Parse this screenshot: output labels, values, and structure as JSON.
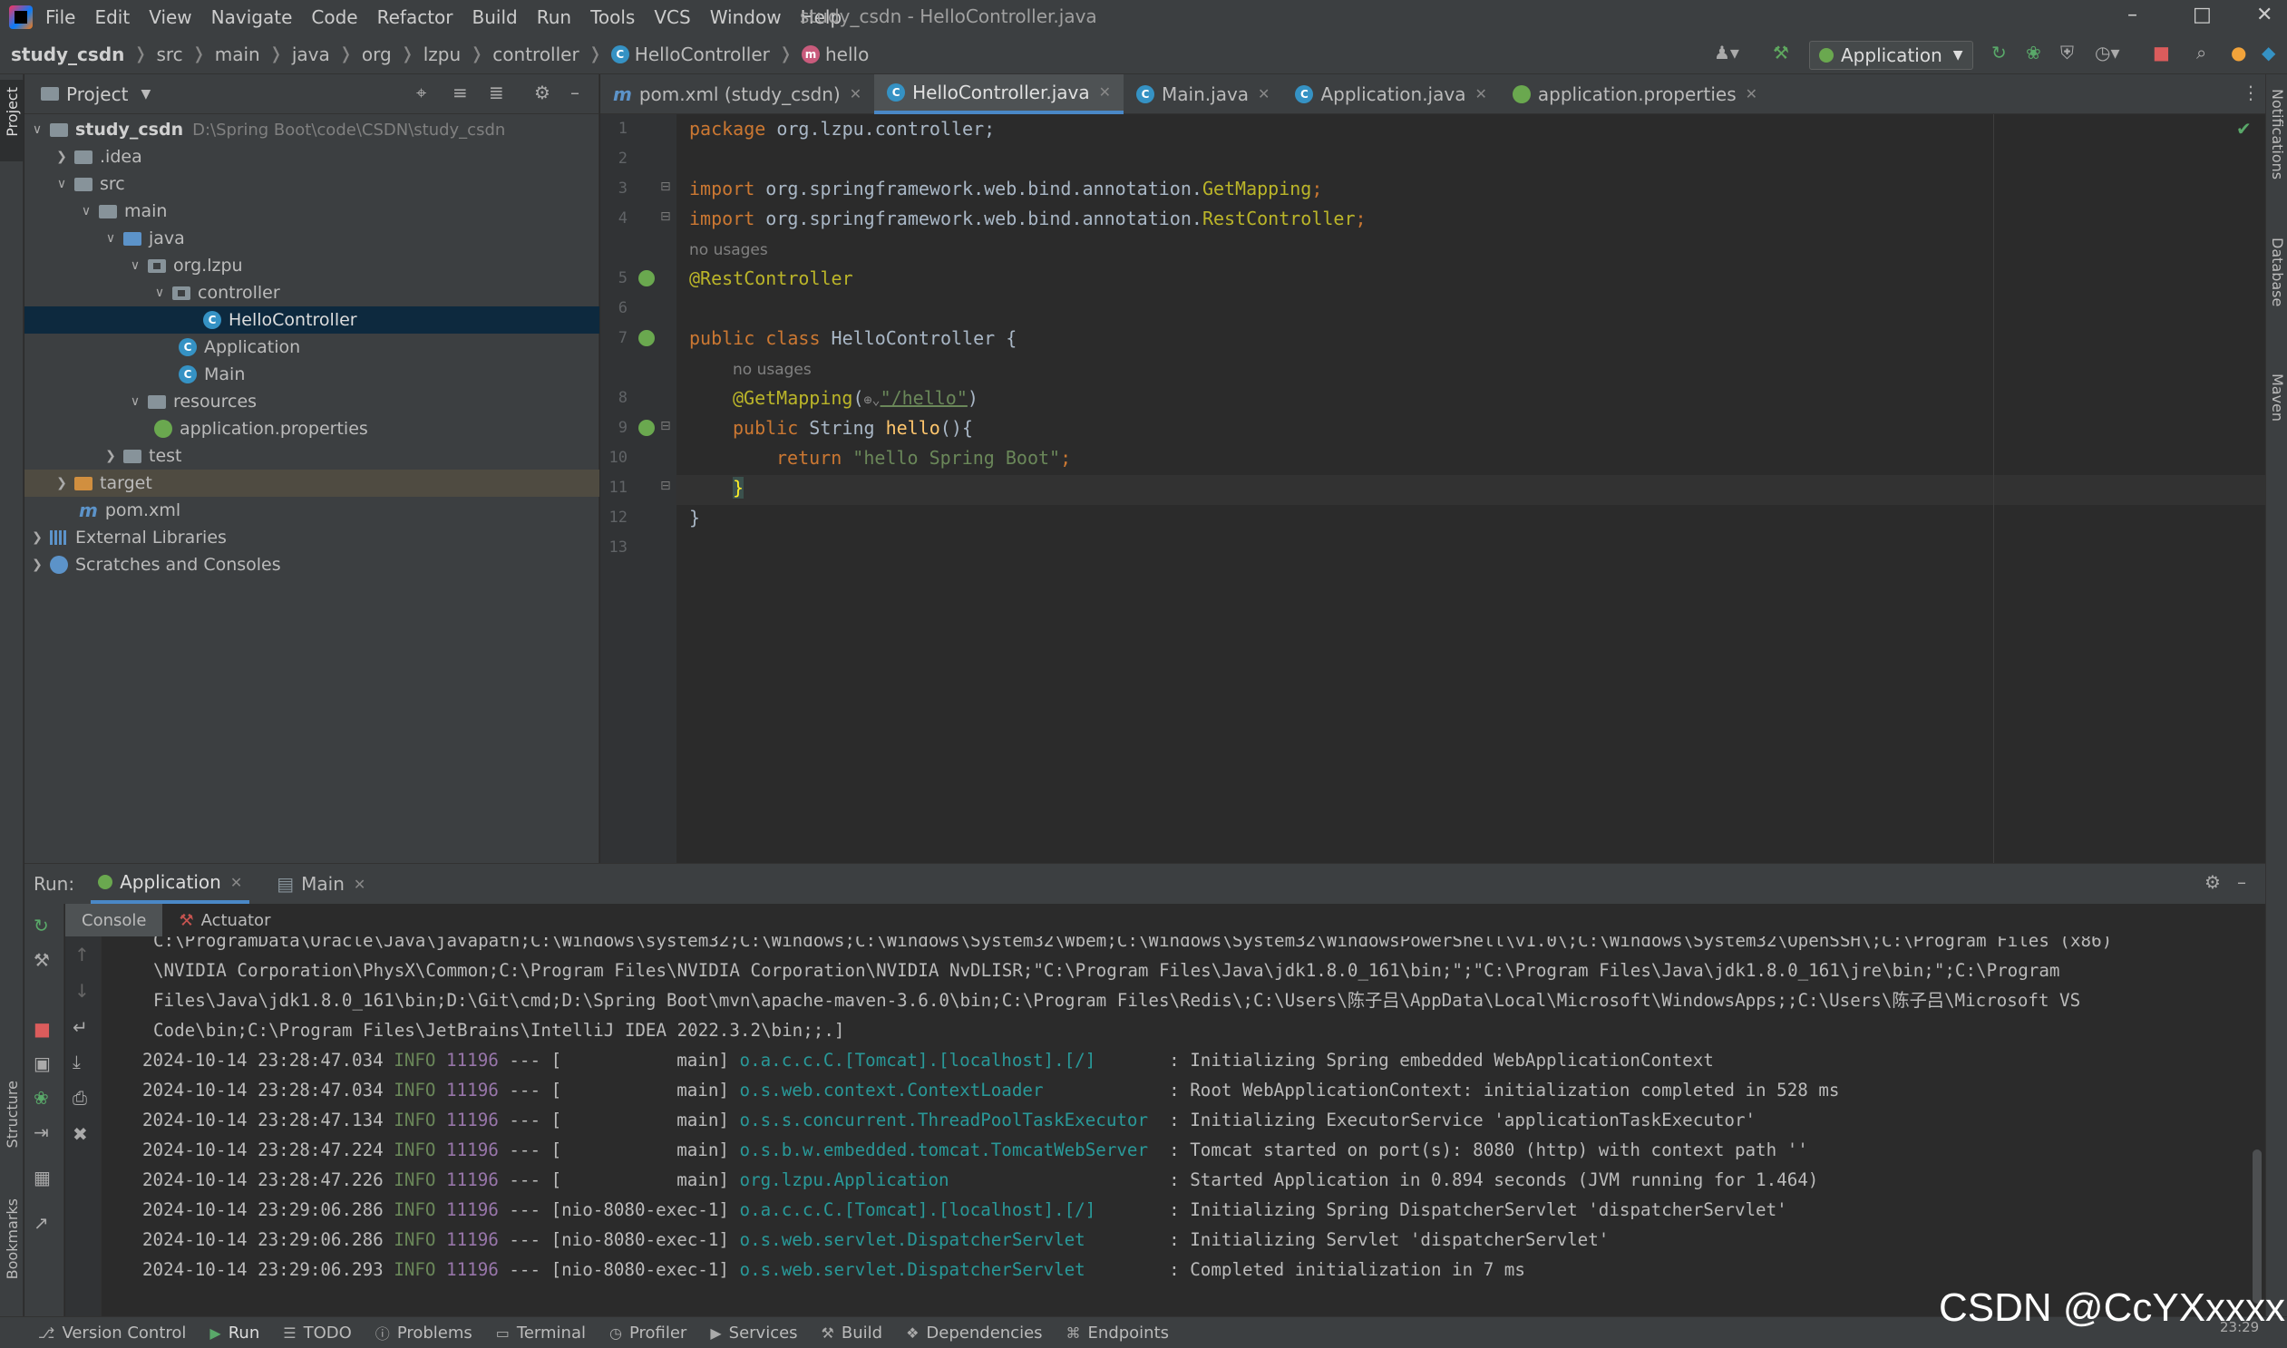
{
  "app": {
    "title": "study_csdn - HelloController.java"
  },
  "menu": [
    "File",
    "Edit",
    "View",
    "Navigate",
    "Code",
    "Refactor",
    "Build",
    "Run",
    "Tools",
    "VCS",
    "Window",
    "Help"
  ],
  "breadcrumb": [
    "study_csdn",
    "src",
    "main",
    "java",
    "org",
    "lzpu",
    "controller",
    "HelloController",
    "hello"
  ],
  "run_config": "Application",
  "project_panel": {
    "title": "Project",
    "tree": [
      {
        "label": "study_csdn",
        "note": "D:\\Spring Boot\\code\\CSDN\\study_csdn"
      },
      {
        "label": ".idea"
      },
      {
        "label": "src"
      },
      {
        "label": "main"
      },
      {
        "label": "java"
      },
      {
        "label": "org.lzpu"
      },
      {
        "label": "controller"
      },
      {
        "label": "HelloController"
      },
      {
        "label": "Application"
      },
      {
        "label": "Main"
      },
      {
        "label": "resources"
      },
      {
        "label": "application.properties"
      },
      {
        "label": "test"
      },
      {
        "label": "target"
      },
      {
        "label": "pom.xml"
      },
      {
        "label": "External Libraries"
      },
      {
        "label": "Scratches and Consoles"
      }
    ]
  },
  "editor": {
    "tabs": [
      "pom.xml (study_csdn)",
      "HelloController.java",
      "Main.java",
      "Application.java",
      "application.properties"
    ],
    "active_tab": "HelloController.java",
    "lines": [
      {
        "n": "1",
        "pkg_kw": "package",
        "pkg_name": " org.lzpu.controller;"
      },
      {
        "n": "2"
      },
      {
        "n": "3",
        "imp_kw": "import",
        "imp_path": " org.springframework.web.bind.annotation.",
        "imp_ann": "GetMapping",
        "semi": ";"
      },
      {
        "n": "4",
        "imp_kw": "import",
        "imp_path": " org.springframework.web.bind.annotation.",
        "imp_ann": "RestController",
        "semi": ";"
      },
      {
        "hint": "no usages"
      },
      {
        "n": "5",
        "ann": "@RestController"
      },
      {
        "n": "6"
      },
      {
        "n": "7",
        "kw": "public class",
        "name": " HelloController {"
      },
      {
        "hint": "no usages"
      },
      {
        "n": "8",
        "ann": "@GetMapping",
        "paren_open": "(",
        "globe": "⊕⌄",
        "str": "\"/hello\"",
        "paren_close": ")"
      },
      {
        "n": "9",
        "kw": "public",
        "type": " String ",
        "meth": "hello",
        "rest": "(){"
      },
      {
        "n": "10",
        "kw": "return",
        "str": " \"hello Spring Boot\"",
        "semi": ";"
      },
      {
        "n": "11",
        "brace": "}"
      },
      {
        "n": "12",
        "brace": "}"
      },
      {
        "n": "13"
      }
    ]
  },
  "run_panel": {
    "label": "Run:",
    "tabs": [
      "Application",
      "Main"
    ],
    "sub_tabs": [
      "Console",
      "Actuator"
    ],
    "path_lines": [
      "C:\\ProgramData\\Oracle\\Java\\javapath;C:\\Windows\\system32;C:\\Windows;C:\\Windows\\System32\\Wbem;C:\\Windows\\System32\\WindowsPowerShell\\v1.0\\;C:\\Windows\\System32\\OpenSSH\\;C:\\Program Files (x86)",
      "\\NVIDIA Corporation\\PhysX\\Common;C:\\Program Files\\NVIDIA Corporation\\NVIDIA NvDLISR;\"C:\\Program Files\\Java\\jdk1.8.0_161\\bin;\";\"C:\\Program Files\\Java\\jdk1.8.0_161\\jre\\bin;\";C:\\Program",
      "Files\\Java\\jdk1.8.0_161\\bin;D:\\Git\\cmd;D:\\Spring Boot\\mvn\\apache-maven-3.6.0\\bin;C:\\Program Files\\Redis\\;C:\\Users\\陈子吕\\AppData\\Local\\Microsoft\\WindowsApps;;C:\\Users\\陈子吕\\Microsoft VS",
      "Code\\bin;C:\\Program Files\\JetBrains\\IntelliJ IDEA 2022.3.2\\bin;;.]"
    ],
    "logs": [
      {
        "ts": "2024-10-14 23:28:47.034",
        "lvl": "INFO",
        "pid": "11196",
        "thread": " --- [           main] ",
        "logger": "o.a.c.c.C.[Tomcat].[localhost].[/]      ",
        "msg": " : Initializing Spring embedded WebApplicationContext"
      },
      {
        "ts": "2024-10-14 23:28:47.034",
        "lvl": "INFO",
        "pid": "11196",
        "thread": " --- [           main] ",
        "logger": "o.s.web.context.ContextLoader           ",
        "msg": " : Root WebApplicationContext: initialization completed in 528 ms"
      },
      {
        "ts": "2024-10-14 23:28:47.134",
        "lvl": "INFO",
        "pid": "11196",
        "thread": " --- [           main] ",
        "logger": "o.s.s.concurrent.ThreadPoolTaskExecutor ",
        "msg": " : Initializing ExecutorService 'applicationTaskExecutor'"
      },
      {
        "ts": "2024-10-14 23:28:47.224",
        "lvl": "INFO",
        "pid": "11196",
        "thread": " --- [           main] ",
        "logger": "o.s.b.w.embedded.tomcat.TomcatWebServer ",
        "msg": " : Tomcat started on port(s): 8080 (http) with context path ''"
      },
      {
        "ts": "2024-10-14 23:28:47.226",
        "lvl": "INFO",
        "pid": "11196",
        "thread": " --- [           main] ",
        "logger": "org.lzpu.Application                    ",
        "msg": " : Started Application in 0.894 seconds (JVM running for 1.464)"
      },
      {
        "ts": "2024-10-14 23:29:06.286",
        "lvl": "INFO",
        "pid": "11196",
        "thread": " --- [nio-8080-exec-1] ",
        "logger": "o.a.c.c.C.[Tomcat].[localhost].[/]      ",
        "msg": " : Initializing Spring DispatcherServlet 'dispatcherServlet'"
      },
      {
        "ts": "2024-10-14 23:29:06.286",
        "lvl": "INFO",
        "pid": "11196",
        "thread": " --- [nio-8080-exec-1] ",
        "logger": "o.s.web.servlet.DispatcherServlet       ",
        "msg": " : Initializing Servlet 'dispatcherServlet'"
      },
      {
        "ts": "2024-10-14 23:29:06.293",
        "lvl": "INFO",
        "pid": "11196",
        "thread": " --- [nio-8080-exec-1] ",
        "logger": "o.s.web.servlet.DispatcherServlet       ",
        "msg": " : Completed initialization in 7 ms"
      }
    ]
  },
  "left_strip": {
    "project": "Project",
    "structure": "Structure",
    "bookmarks": "Bookmarks"
  },
  "right_strip": {
    "notifications": "Notifications",
    "database": "Database",
    "maven": "Maven"
  },
  "status_bar": [
    "Version Control",
    "Run",
    "TODO",
    "Problems",
    "Terminal",
    "Profiler",
    "Services",
    "Build",
    "Dependencies",
    "Endpoints"
  ],
  "clock": "23:29",
  "watermark": "CSDN @CcYXxxxx",
  "colors": {
    "keyword": "#cc7832",
    "annotation": "#bbb529",
    "string": "#6a8759",
    "method": "#ffc66d",
    "log_info": "#6a8759",
    "log_pid": "#9876aa",
    "logger": "#299999",
    "selection": "#0d293e",
    "accent": "#4a88c7"
  }
}
